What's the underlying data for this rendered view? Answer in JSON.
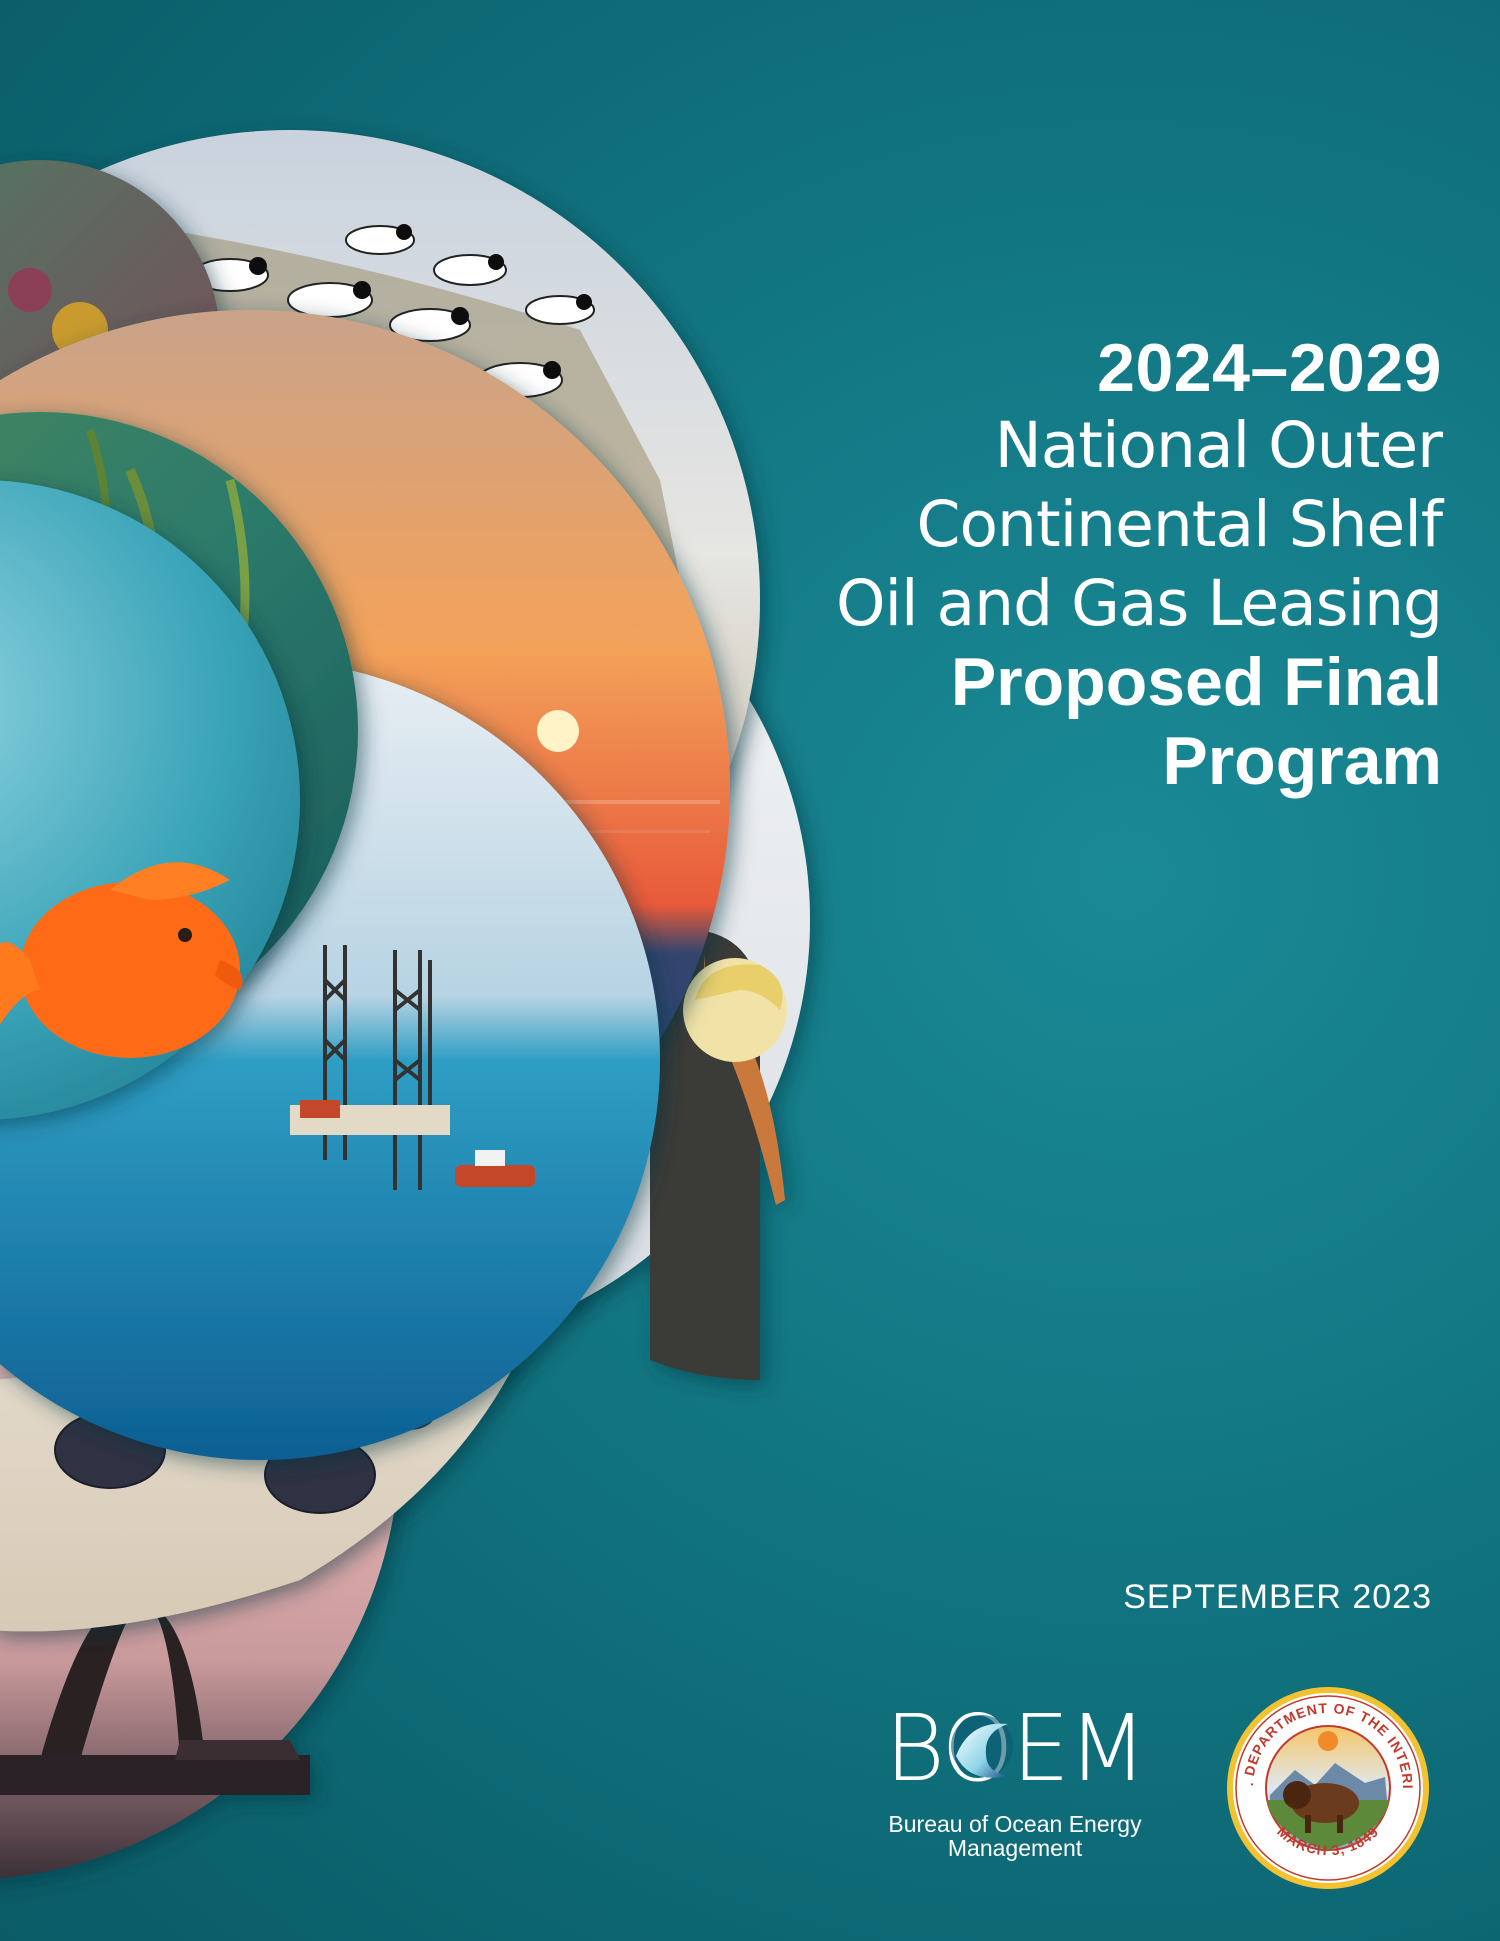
{
  "cover": {
    "title_years": "2024–2029",
    "title_line1": "National Outer",
    "title_line2": "Continental Shelf",
    "title_line3": "Oil and Gas Leasing",
    "title_line4": "Proposed Final",
    "title_line5": "Program",
    "date": "SEPTEMBER 2023"
  },
  "logos": {
    "boem_wordmark": "BOEM",
    "boem_name_line1": "Bureau of Ocean Energy",
    "boem_name_line2": "Management",
    "seal_top_text": "U.S. DEPARTMENT OF THE INTERIOR",
    "seal_bottom_text": "MARCH 3, 1849"
  },
  "colors": {
    "background": "#137a86",
    "text": "#ffffff"
  }
}
